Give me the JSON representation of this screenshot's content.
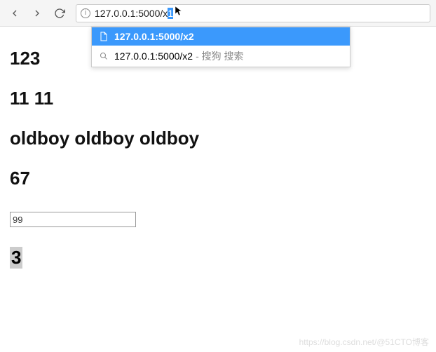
{
  "browser": {
    "url_base": "127.0.0.1:5000/x",
    "url_selected": "1"
  },
  "dropdown": {
    "items": [
      {
        "text": "127.0.0.1:5000/x2",
        "suffix": "",
        "active": true,
        "icon": "page"
      },
      {
        "text": "127.0.0.1:5000/x2",
        "suffix": "- 搜狗 搜索",
        "active": false,
        "icon": "search"
      }
    ]
  },
  "page": {
    "h1": "123",
    "h2": "11 11",
    "h3": "oldboy oldboy oldboy",
    "h4": "67",
    "input_value": "99",
    "selected_text": "3"
  },
  "watermark": "https://blog.csdn.net/@51CTO博客"
}
